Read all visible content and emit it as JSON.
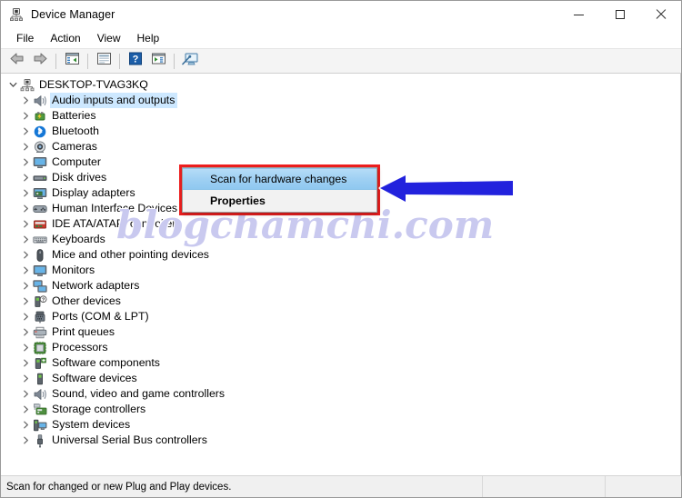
{
  "window": {
    "title": "Device Manager",
    "icon": "device-manager-icon",
    "controls": {
      "minimize": "—",
      "maximize": "□",
      "close": "✕"
    }
  },
  "menubar": {
    "items": [
      {
        "label": "File",
        "name": "menu-file"
      },
      {
        "label": "Action",
        "name": "menu-action"
      },
      {
        "label": "View",
        "name": "menu-view"
      },
      {
        "label": "Help",
        "name": "menu-help"
      }
    ]
  },
  "toolbar": {
    "buttons": [
      {
        "name": "back-icon",
        "title": "Back"
      },
      {
        "name": "forward-icon",
        "title": "Forward"
      },
      {
        "name": "show-hide-console-tree-icon",
        "title": "Show/Hide Console Tree"
      },
      {
        "name": "properties-icon",
        "title": "Properties"
      },
      {
        "name": "help-icon",
        "title": "Help"
      },
      {
        "name": "update-driver-icon",
        "title": "Update Driver"
      },
      {
        "name": "scan-for-hardware-changes-icon",
        "title": "Scan for hardware changes"
      }
    ]
  },
  "tree": {
    "root": {
      "label": "DESKTOP-TVAG3KQ",
      "icon": "computer-root-icon",
      "expanded": true
    },
    "nodes": [
      {
        "label": "Audio inputs and outputs",
        "icon": "speaker-icon",
        "selected": true
      },
      {
        "label": "Batteries",
        "icon": "battery-icon",
        "selected": false
      },
      {
        "label": "Bluetooth",
        "icon": "bluetooth-icon",
        "selected": false
      },
      {
        "label": "Cameras",
        "icon": "camera-icon",
        "selected": false
      },
      {
        "label": "Computer",
        "icon": "monitor-icon",
        "selected": false
      },
      {
        "label": "Disk drives",
        "icon": "disk-drive-icon",
        "selected": false
      },
      {
        "label": "Display adapters",
        "icon": "display-adapter-icon",
        "selected": false
      },
      {
        "label": "Human Interface Devices",
        "icon": "hid-icon",
        "selected": false
      },
      {
        "label": "IDE ATA/ATAPI controllers",
        "icon": "ide-controller-icon",
        "selected": false
      },
      {
        "label": "Keyboards",
        "icon": "keyboard-icon",
        "selected": false
      },
      {
        "label": "Mice and other pointing devices",
        "icon": "mouse-icon",
        "selected": false
      },
      {
        "label": "Monitors",
        "icon": "monitor-icon",
        "selected": false
      },
      {
        "label": "Network adapters",
        "icon": "network-adapter-icon",
        "selected": false
      },
      {
        "label": "Other devices",
        "icon": "other-device-icon",
        "selected": false
      },
      {
        "label": "Ports (COM & LPT)",
        "icon": "port-icon",
        "selected": false
      },
      {
        "label": "Print queues",
        "icon": "printer-icon",
        "selected": false
      },
      {
        "label": "Processors",
        "icon": "processor-icon",
        "selected": false
      },
      {
        "label": "Software components",
        "icon": "software-component-icon",
        "selected": false
      },
      {
        "label": "Software devices",
        "icon": "software-device-icon",
        "selected": false
      },
      {
        "label": "Sound, video and game controllers",
        "icon": "speaker-icon",
        "selected": false
      },
      {
        "label": "Storage controllers",
        "icon": "storage-controller-icon",
        "selected": false
      },
      {
        "label": "System devices",
        "icon": "system-device-icon",
        "selected": false
      },
      {
        "label": "Universal Serial Bus controllers",
        "icon": "usb-icon",
        "selected": false
      }
    ]
  },
  "context_menu": {
    "items": [
      {
        "label": "Scan for hardware changes",
        "highlighted": true,
        "bold": false
      },
      {
        "label": "Properties",
        "highlighted": false,
        "bold": true
      }
    ]
  },
  "annotation": {
    "highlight_color": "#ef1f1f",
    "arrow_color": "#2222dd",
    "arrow_direction": "left"
  },
  "watermark": {
    "text": "blogchamchi.com",
    "color": "#c9c9ef"
  },
  "statusbar": {
    "message": "Scan for changed or new Plug and Play devices.",
    "cell2": "",
    "cell3": ""
  }
}
